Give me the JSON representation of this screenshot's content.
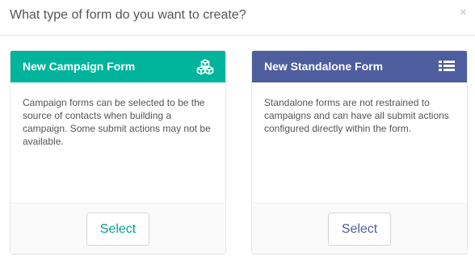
{
  "modal": {
    "title": "What type of form do you want to create?",
    "close_glyph": "×"
  },
  "cards": [
    {
      "title": "New Campaign Form",
      "icon": "cubes-icon",
      "header_color": "#00b49c",
      "description": "Campaign forms can be selected to be the source of contacts when building a campaign. Some submit actions may not be available.",
      "button_label": "Select"
    },
    {
      "title": "New Standalone Form",
      "icon": "list-icon",
      "header_color": "#4e5d9d",
      "description": "Standalone forms are not restrained to campaigns and can have all submit actions configured directly within the form.",
      "button_label": "Select"
    }
  ]
}
